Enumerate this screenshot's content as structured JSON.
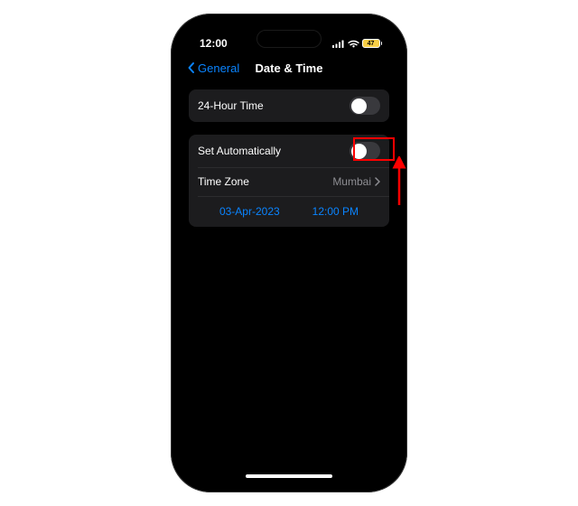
{
  "status": {
    "time": "12:00",
    "battery_text": "47"
  },
  "nav": {
    "back_label": "General",
    "title": "Date & Time"
  },
  "rows": {
    "twenty_four_hour": "24-Hour Time",
    "set_auto": "Set Automatically",
    "time_zone_label": "Time Zone",
    "time_zone_value": "Mumbai"
  },
  "picker": {
    "date": "03-Apr-2023",
    "time": "12:00 PM"
  },
  "colors": {
    "accent": "#0a84ff",
    "highlight": "#ff0000",
    "battery": "#f7ce46"
  }
}
